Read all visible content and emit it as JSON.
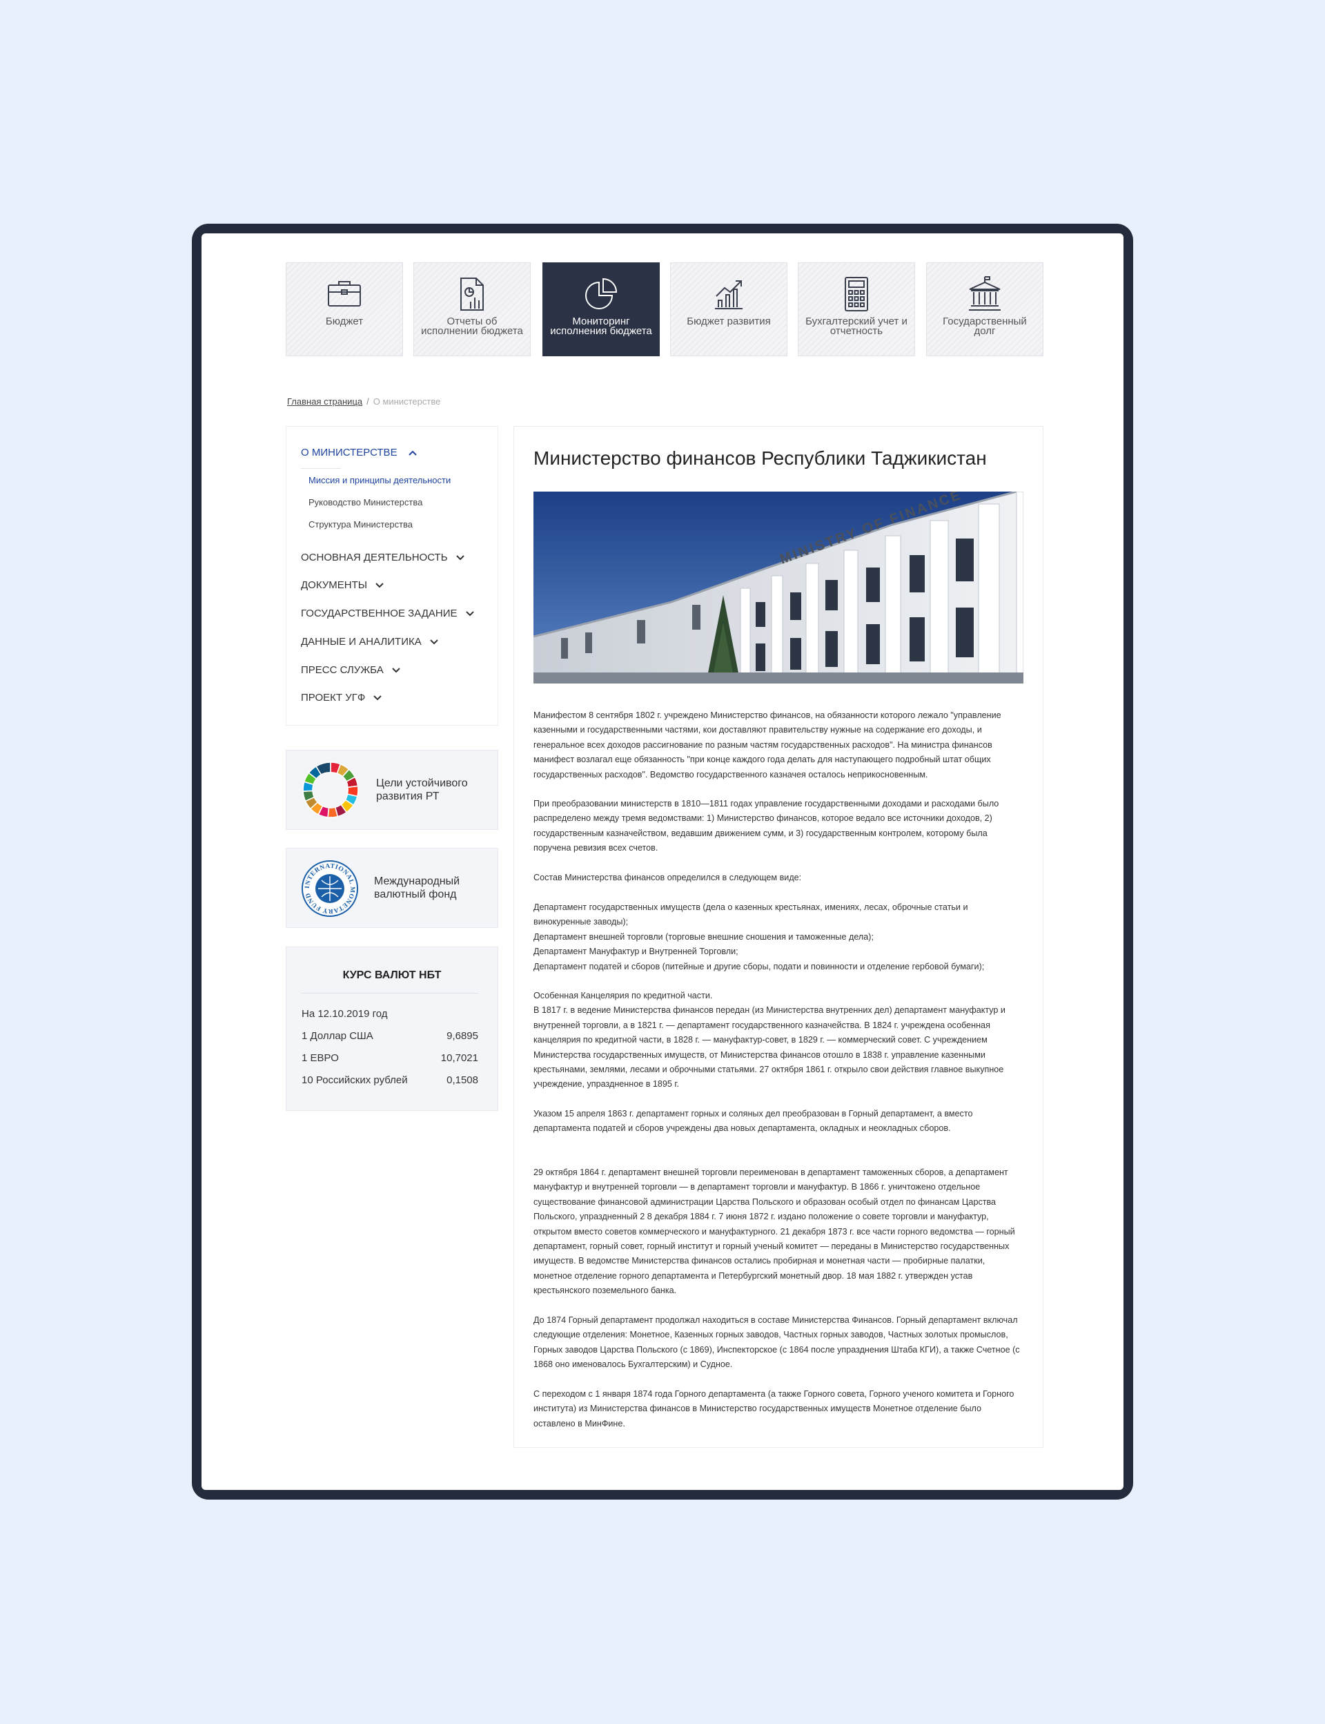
{
  "tiles": [
    {
      "label": "Бюджет",
      "icon": "briefcase-icon"
    },
    {
      "label": "Отчеты об исполнении бюджета",
      "icon": "report-chart-icon"
    },
    {
      "label": "Мониторинг исполнения бюджета",
      "icon": "pie-chart-icon"
    },
    {
      "label": "Бюджет развития",
      "icon": "growth-chart-icon"
    },
    {
      "label": "Бухгалтерский учет и отчетность",
      "icon": "calculator-icon"
    },
    {
      "label": "Государственный долг",
      "icon": "government-building-icon"
    }
  ],
  "active_tile": "Мониторинг исполнения бюджета",
  "breadcrumb": {
    "home": "Главная страница",
    "separator": "/",
    "current": "О министерстве"
  },
  "sidebar": {
    "header": "О МИНИСТЕРСТВЕ",
    "subitems": [
      "Миссия и принципы деятельности",
      "Руководство Министерства",
      "Структура Министерства"
    ],
    "items": [
      "ОСНОВНАЯ ДЕЯТЕЛЬНОСТЬ",
      "ДОКУМЕНТЫ",
      "ГОСУДАРСТВЕННОЕ ЗАДАНИЕ",
      "ДАННЫЕ И АНАЛИТИКА",
      "ПРЕСС СЛУЖБА",
      "ПРОЕКТ УГФ"
    ]
  },
  "cards": {
    "sdg": "Цели устойчивого развития РТ",
    "imf": "Международный валютный фонд",
    "imf_logo_text": "INTERNATIONAL MONETARY FUND"
  },
  "rates": {
    "title": "КУРС ВАЛЮТ НБТ",
    "date": "На 12.10.2019 год",
    "rows": [
      {
        "name": "1 Доллар США",
        "value": "9,6895"
      },
      {
        "name": "1 ЕВРО",
        "value": "10,7021"
      },
      {
        "name": "10 Российских рублей",
        "value": "0,1508"
      }
    ]
  },
  "main": {
    "title": "Министерство финансов Республики Таджикистан",
    "photo_sign": "MINISTRY OF FINANCE",
    "paragraphs": [
      "Манифестом 8 сентября 1802 г. учреждено Министерство финансов, на обязанности которого лежало \"управление казенными и государственными частями, кои доставляют правительству нужные на содержание его доходы, и генеральное всех доходов рассигнование по разным частям государственных расходов\". На министра финансов манифест возлагал еще обязанность \"при конце каждого года делать для наступающего подробный штат общих государственных расходов\". Ведомство государственного казначея осталось неприкосновенным.",
      "При преобразовании министерств в 1810—1811 годах управление государственными доходами и расходами было распределено между тремя ведомствами: 1) Министерство финансов, которое ведало все источники доходов, 2) государственным казначейством, ведавшим движением сумм, и 3) государственным контролем, которому была поручена ревизия всех счетов.",
      "Состав Министерства финансов определился в следующем виде:",
      "Департамент государственных имуществ (дела о казенных крестьянах, имениях, лесах, оброчные статьи и винокуренные заводы);\nДепартамент внешней торговли (торговые внешние сношения и таможенные дела);\nДепартамент Мануфактур и Внутренней Торговли;\nДепартамент податей и сборов (питейные и другие сборы, подати и повинности и отделение гербовой бумаги);",
      "Особенная Канцелярия по кредитной части.\nВ 1817 г. в ведение Министерства финансов передан (из Министерства внутренних дел) департамент мануфактур и внутренней торговли, а в 1821 г. — департамент государственного казначейства. В 1824 г. учреждена особенная канцелярия по кредитной части, в 1828 г. — мануфактур-совет, в 1829 г. — коммерческий совет. С учреждением Министерства государственных имуществ, от Министерства финансов отошло в 1838 г. управление казенными крестьянами, землями, лесами и оброчными статьями. 27 октября 1861 г. открыло свои действия главное выкупное учреждение, упраздненное в 1895 г.",
      "Указом 15 апреля 1863 г. департамент горных и соляных дел преобразован в Горный департамент, а вместо департамента податей и сборов учреждены два новых департамента, окладных и неокладных сборов.",
      "29 октября 1864 г. департамент внешней торговли переименован в департамент таможенных сборов, а департамент мануфактур и внутренней торговли — в департамент торговли и мануфактур. В 1866 г. уничтожено отдельное существование финансовой администрации Царства Польского и образован особый отдел по финансам Царства Польского, упраздненный 2 8 декабря 1884 г. 7 июня 1872 г. издано положение о совете торговли и мануфактур, открытом вместо советов коммерческого и мануфактурного. 21 декабря 1873 г. все части горного ведомства — горный департамент, горный совет, горный институт и горный ученый комитет — переданы в Министерство государственных имуществ. В ведомстве Министерства финансов остались пробирная и монетная части — пробирные палатки, монетное отделение горного департамента и Петербургский монетный двор. 18 мая 1882 г. утвержден устав крестьянского поземельного банка.",
      "До 1874 Горный департамент продолжал находиться в составе Министерства Финансов. Горный департамент включал следующие отделения: Монетное, Казенных горных заводов, Частных горных заводов, Частных золотых промыслов, Горных заводов Царства Польского (с 1869), Инспекторское (с 1864 после упразднения Штаба КГИ), а также Счетное (с 1868 оно именовалось Бухгалтерским) и Судное.",
      "С переходом с 1 января 1874 года Горного департамента (а также Горного совета, Горного ученого комитета и Горного института) из Министерства финансов в Министерство государственных имуществ Монетное отделение было оставлено в МинФине."
    ]
  },
  "colors": {
    "background": "#e7f0fc",
    "frame": "#242b3c",
    "active_tile": "#2c3245",
    "link_blue": "#1e44a0"
  }
}
